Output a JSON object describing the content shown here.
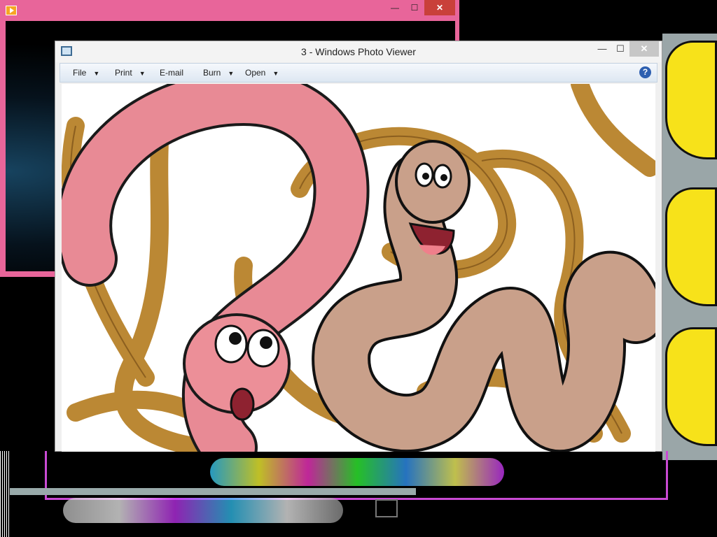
{
  "photo_viewer": {
    "title": "3 - Windows Photo Viewer",
    "controls": {
      "minimize": "—",
      "maximize": "☐",
      "close": "✕"
    },
    "toolbar": {
      "file": "File",
      "print": "Print",
      "email": "E-mail",
      "burn": "Burn",
      "open": "Open",
      "help": "?"
    },
    "image": {
      "subject": "cartoon worms",
      "colors": {
        "pink_worm": "#e88a95",
        "brown_worm": "#c9a08a",
        "bg_worms": "#b8822a"
      }
    }
  },
  "background_window": {
    "controls": {
      "minimize": "—",
      "maximize": "☐",
      "close": "✕"
    },
    "frame_color": "#e8659a"
  },
  "right_app": {
    "accent": "#f7e21a"
  }
}
